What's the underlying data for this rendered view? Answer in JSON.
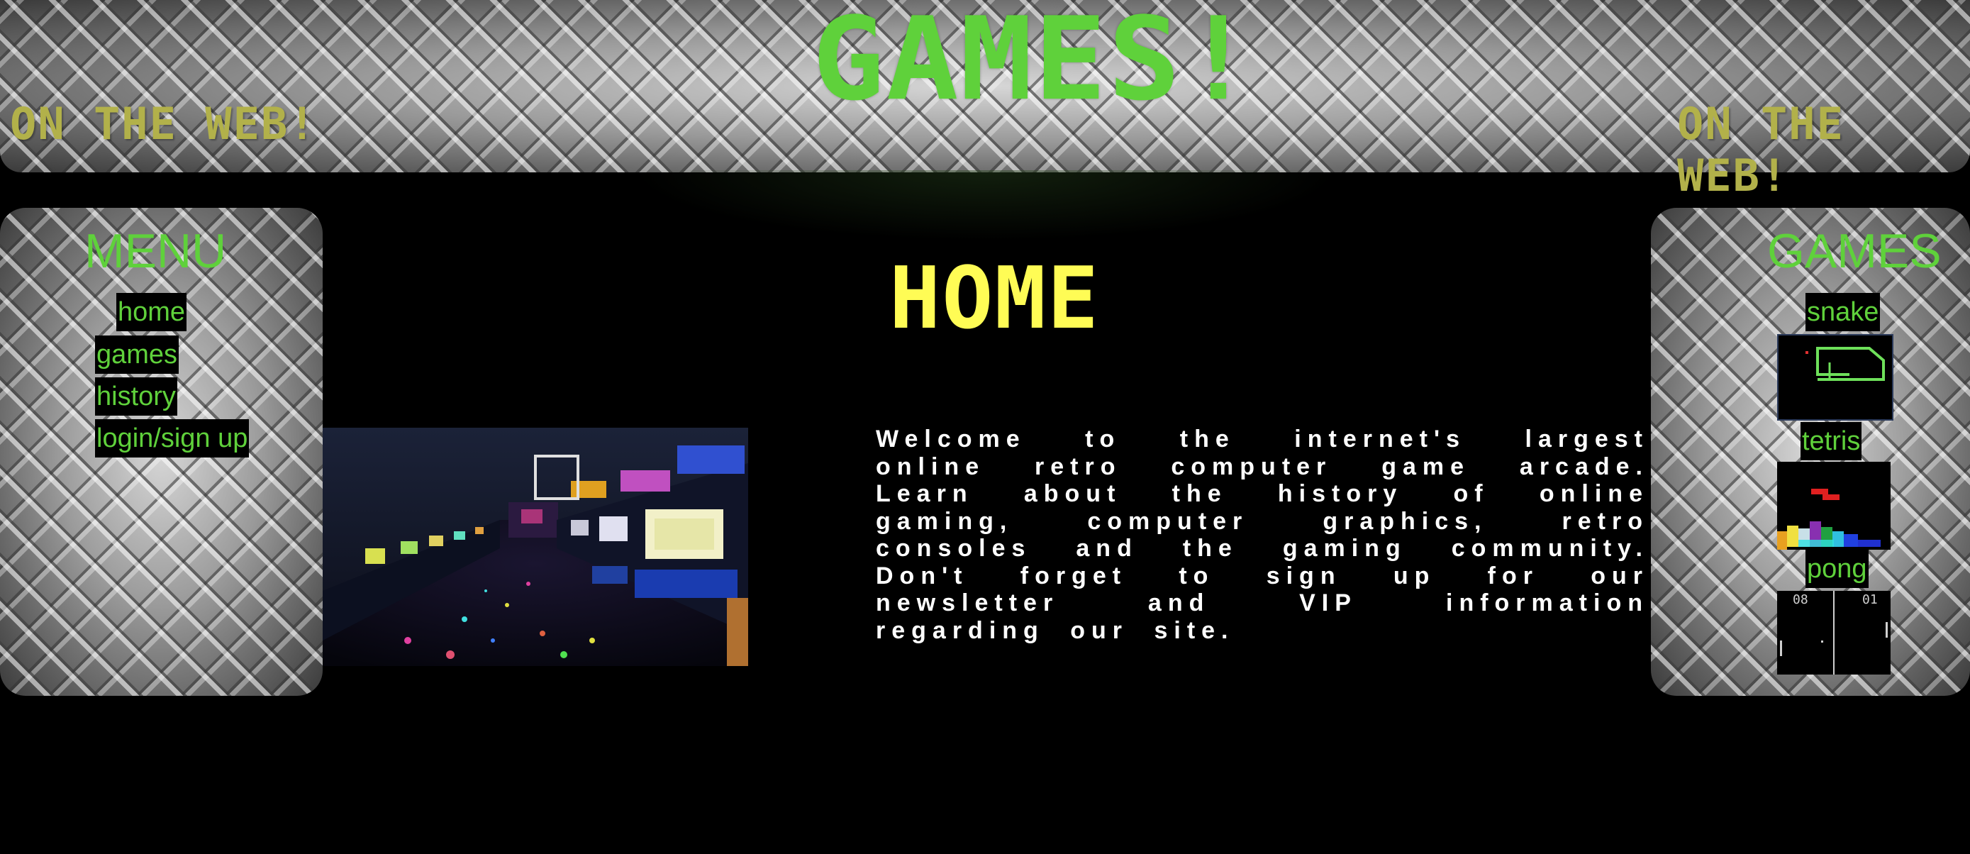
{
  "header": {
    "title": "GAMES!",
    "tagline_left": "ON THE WEB!",
    "tagline_right": "ON THE WEB!"
  },
  "menu": {
    "title": "MENU",
    "items": [
      {
        "label": "home"
      },
      {
        "label": "games"
      },
      {
        "label": "history"
      },
      {
        "label": "login/sign up"
      }
    ]
  },
  "games": {
    "title": "GAMES",
    "items": [
      {
        "label": "snake"
      },
      {
        "label": "tetris"
      },
      {
        "label": "pong"
      }
    ],
    "pong_score_left": "08",
    "pong_score_right": "01"
  },
  "main": {
    "heading": "HOME",
    "welcome_text": "Welcome to the internet's largest online retro computer game arcade. Learn about the history of online gaming, computer graphics, retro consoles and the gaming community. Don't forget to sign up for our newsletter and VIP information regarding our site."
  },
  "colors": {
    "title_green": "#5fd13b",
    "tagline_olive": "#b2b14a",
    "heading_yellow": "#fffc55",
    "background": "#000000"
  }
}
